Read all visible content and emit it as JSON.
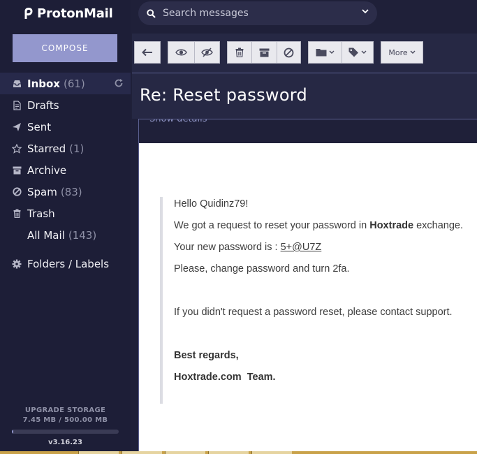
{
  "app": {
    "logo_text": "ProtonMail",
    "compose_label": "COMPOSE",
    "accent_color": "#9397cd"
  },
  "sidebar": {
    "items": [
      {
        "label": "Inbox",
        "count": "(61)",
        "icon": "inbox-icon",
        "active": true
      },
      {
        "label": "Drafts",
        "count": "",
        "icon": "drafts-icon"
      },
      {
        "label": "Sent",
        "count": "",
        "icon": "paper-plane-icon"
      },
      {
        "label": "Starred",
        "count": "(1)",
        "icon": "star-icon"
      },
      {
        "label": "Archive",
        "count": "",
        "icon": "archive-icon"
      },
      {
        "label": "Spam",
        "count": "(83)",
        "icon": "ban-icon"
      },
      {
        "label": "Trash",
        "count": "",
        "icon": "trash-icon"
      },
      {
        "label": "All Mail",
        "count": "(143)",
        "icon": ""
      }
    ],
    "folders_label": "Folders / Labels",
    "storage": {
      "heading": "UPGRADE STORAGE",
      "usage": "7.45 MB / 500.00 MB",
      "used_fraction": 0.0149
    },
    "version": "v3.16.23"
  },
  "search": {
    "placeholder": "Search messages"
  },
  "toolbar": {
    "more_label": "More"
  },
  "message": {
    "subject": "Re: Reset password",
    "details_link": "Show details",
    "greeting": "Hello Quidinz79!",
    "line1_pre": "We got a request to reset your password in ",
    "line1_bold": "Hoxtrade",
    "line1_post": " exchange.",
    "line2_pre": "Your new password is : ",
    "line2_link": "5+@U7Z",
    "line3": "Please, change password and turn 2fa.",
    "line4": "If you didn't request a password reset, please contact support.",
    "signoff": "Best regards,",
    "team": "Hoxtrade.com  Team."
  }
}
